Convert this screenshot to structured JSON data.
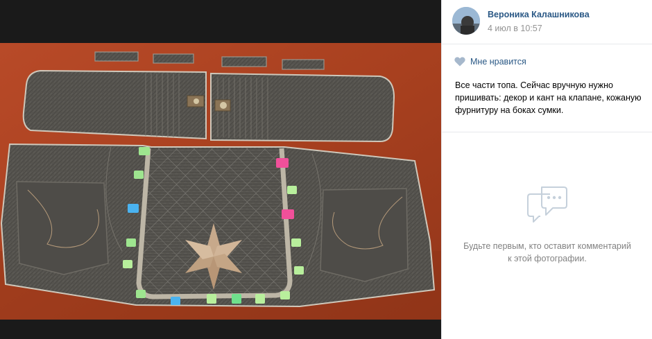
{
  "author": {
    "name": "Вероника Калашникова",
    "date": "4 июл в 10:57"
  },
  "actions": {
    "like_label": "Мне нравится"
  },
  "post": {
    "description": "Все части топа. Сейчас вручную нужно пришивать: декор и кант на клапане, кожаную фурнитуру на боках сумки."
  },
  "comments": {
    "empty_text": "Будьте первым, кто оставит комментарий к этой фотографии."
  },
  "icons": {
    "like": "heart-icon",
    "comments": "comment-bubble-icon"
  },
  "colors": {
    "link": "#2a5885",
    "muted": "#828282",
    "date": "#939393",
    "icon": "#c5d0db",
    "viewer_bg": "#1a1a1a",
    "table": "#b5482a",
    "denim": "#55534f"
  }
}
